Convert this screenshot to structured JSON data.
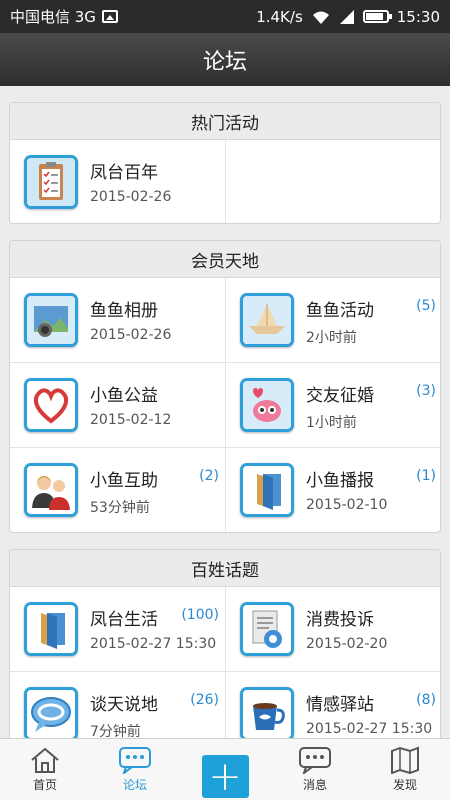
{
  "status_bar": {
    "carrier": "中国电信 3G",
    "speed": "1.4K/s",
    "time": "15:30"
  },
  "title": "论坛",
  "sections": [
    {
      "header": "热门活动",
      "items": [
        {
          "title": "凤台百年",
          "date": "2015-02-26",
          "badge": "",
          "icon": "clipboard-icon"
        }
      ]
    },
    {
      "header": "会员天地",
      "items": [
        {
          "title": "鱼鱼相册",
          "date": "2015-02-26",
          "badge": "",
          "icon": "photo-album-icon"
        },
        {
          "title": "鱼鱼活动",
          "date": "2小时前",
          "badge": "(5)",
          "icon": "paper-boat-icon"
        },
        {
          "title": "小鱼公益",
          "date": "2015-02-12",
          "badge": "",
          "icon": "heart-hand-icon"
        },
        {
          "title": "交友征婚",
          "date": "1小时前",
          "badge": "(3)",
          "icon": "fish-love-icon"
        },
        {
          "title": "小鱼互助",
          "date": "53分钟前",
          "badge": "(2)",
          "icon": "people-icon"
        },
        {
          "title": "小鱼播报",
          "date": "2015-02-10",
          "badge": "(1)",
          "icon": "folder-icon"
        }
      ]
    },
    {
      "header": "百姓话题",
      "items": [
        {
          "title": "凤台生活",
          "date": "2015-02-27 15:30",
          "badge": "(100)",
          "icon": "folder-icon"
        },
        {
          "title": "消费投诉",
          "date": "2015-02-20",
          "badge": "",
          "icon": "complaint-icon"
        },
        {
          "title": "谈天说地",
          "date": "7分钟前",
          "badge": "(26)",
          "icon": "chat-bubble-icon"
        },
        {
          "title": "情感驿站",
          "date": "2015-02-27 15:30",
          "badge": "(8)",
          "icon": "coffee-cup-icon"
        }
      ]
    }
  ],
  "tabs": [
    {
      "label": "首页",
      "icon": "home-icon"
    },
    {
      "label": "论坛",
      "icon": "forum-icon"
    },
    {
      "label": "",
      "icon": "plus-icon"
    },
    {
      "label": "消息",
      "icon": "message-icon"
    },
    {
      "label": "发现",
      "icon": "discover-icon"
    }
  ],
  "colors": {
    "accent": "#1ea0d9",
    "badge": "#2a89d1",
    "title_bar": "#3a3a3a"
  }
}
